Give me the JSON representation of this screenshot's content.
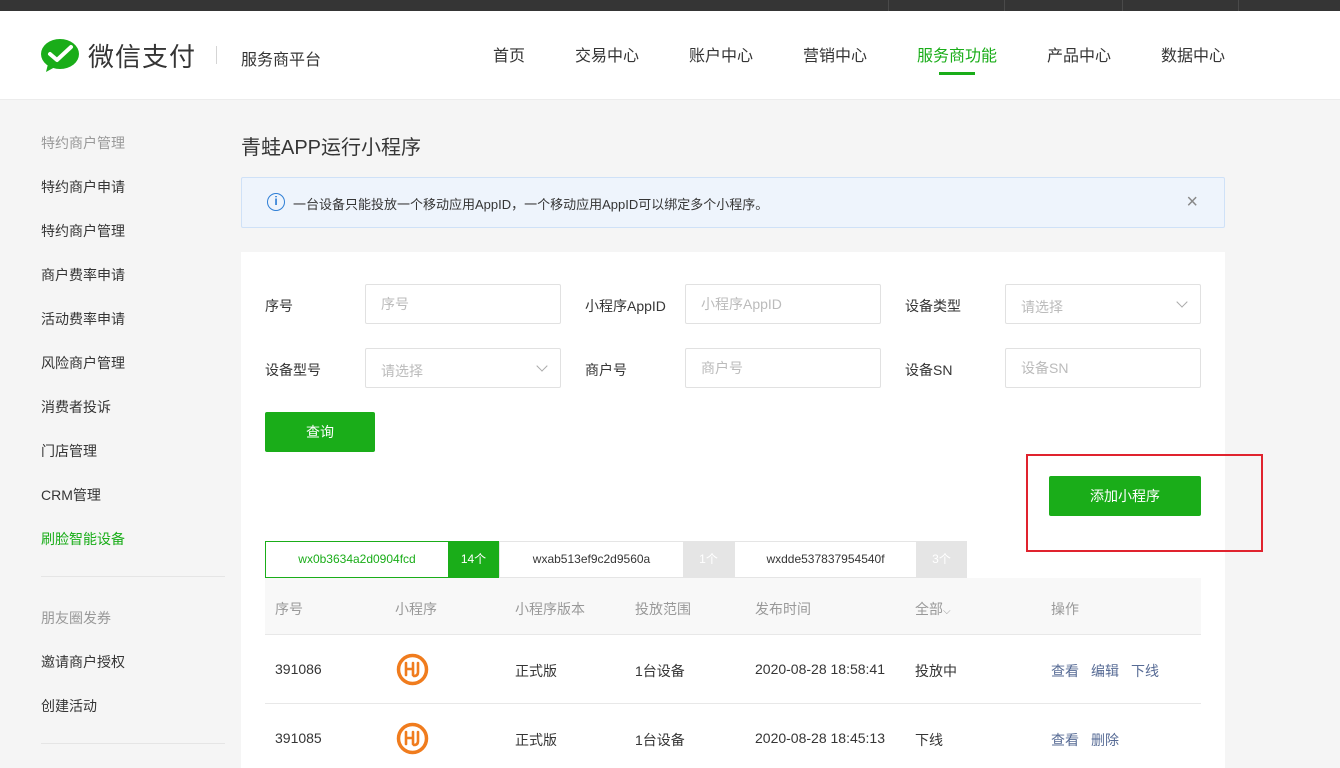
{
  "header": {
    "brand": "微信支付",
    "platform": "服务商平台",
    "nav": [
      {
        "label": "首页"
      },
      {
        "label": "交易中心"
      },
      {
        "label": "账户中心"
      },
      {
        "label": "营销中心"
      },
      {
        "label": "服务商功能"
      },
      {
        "label": "产品中心"
      },
      {
        "label": "数据中心"
      }
    ],
    "active_nav": "服务商功能"
  },
  "sidebar": {
    "groups": [
      {
        "title": "特约商户管理",
        "items": [
          "特约商户申请",
          "特约商户管理",
          "商户费率申请",
          "活动费率申请",
          "风险商户管理",
          "消费者投诉",
          "门店管理",
          "CRM管理",
          "刷脸智能设备"
        ]
      },
      {
        "title": "朋友圈发券",
        "items": [
          "邀请商户授权",
          "创建活动"
        ]
      }
    ],
    "active_item": "刷脸智能设备"
  },
  "page": {
    "title": "青蛙APP运行小程序",
    "notice": "一台设备只能投放一个移动应用AppID，一个移动应用AppID可以绑定多个小程序。"
  },
  "filters": {
    "serial_label": "序号",
    "serial_placeholder": "序号",
    "appid_label": "小程序AppID",
    "appid_placeholder": "小程序AppID",
    "device_type_label": "设备类型",
    "device_type_placeholder": "请选择",
    "device_model_label": "设备型号",
    "device_model_placeholder": "请选择",
    "merchant_label": "商户号",
    "merchant_placeholder": "商户号",
    "sn_label": "设备SN",
    "sn_placeholder": "设备SN",
    "query_button": "查询"
  },
  "add_button": "添加小程序",
  "app_tabs": [
    {
      "appid": "wx0b3634a2d0904fcd",
      "count": "14个",
      "active": true
    },
    {
      "appid": "wxab513ef9c2d9560a",
      "count": "1个",
      "active": false
    },
    {
      "appid": "wxdde537837954540f",
      "count": "3个",
      "active": false
    }
  ],
  "table": {
    "columns": [
      "序号",
      "小程序",
      "小程序版本",
      "投放范围",
      "发布时间",
      "全部",
      "操作"
    ],
    "status_filter_arrow": "⌵",
    "rows": [
      {
        "id": "391086",
        "version": "正式版",
        "scope": "1台设备",
        "time": "2020-08-28 18:58:41",
        "status": "投放中",
        "actions": [
          "查看",
          "编辑",
          "下线"
        ]
      },
      {
        "id": "391085",
        "version": "正式版",
        "scope": "1台设备",
        "time": "2020-08-28 18:45:13",
        "status": "下线",
        "actions": [
          "查看",
          "删除"
        ]
      }
    ]
  },
  "colors": {
    "accent": "#1aad19",
    "link": "#576b95",
    "highlight": "#e0232e"
  }
}
